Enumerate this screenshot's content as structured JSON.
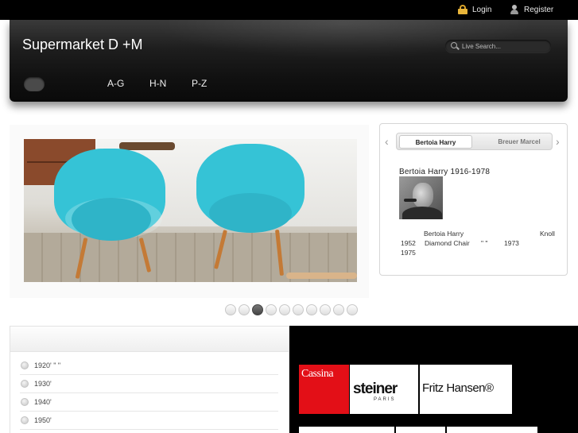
{
  "topbar": {
    "login_label": "Login",
    "register_label": "Register"
  },
  "header": {
    "site_title": "Supermarket D +M",
    "search_placeholder": "Live Search...",
    "nav": [
      {
        "label": "A-G"
      },
      {
        "label": "H-N"
      },
      {
        "label": "P-Z"
      }
    ]
  },
  "slider": {
    "slide_count": 10,
    "active_slide": 3
  },
  "bio": {
    "prev_glyph": "‹",
    "next_glyph": "›",
    "tabs": [
      {
        "label": "Bertoia Harry",
        "active": true
      },
      {
        "label": "Breuer Marcel",
        "active": false
      }
    ],
    "name_line": "Bertoia Harry 1916-1978",
    "info": {
      "name": "Bertoia Harry",
      "company": "Knoll",
      "year1": "1952",
      "product": "Diamond Chair",
      "marks": "\" \"",
      "year2": "1973",
      "year3": "1975"
    }
  },
  "eras": [
    {
      "label": "1920' \"   \""
    },
    {
      "label": "1930'"
    },
    {
      "label": "1940'"
    },
    {
      "label": "1950'"
    }
  ],
  "brands": [
    {
      "name": "Cassina"
    },
    {
      "name": "steiner",
      "sub": "PARIS"
    },
    {
      "name": "Fritz Hansen®"
    }
  ],
  "colors": {
    "accent_chair": "#35c3d6",
    "cassina_red": "#e30f17",
    "header_dark": "#111111"
  }
}
